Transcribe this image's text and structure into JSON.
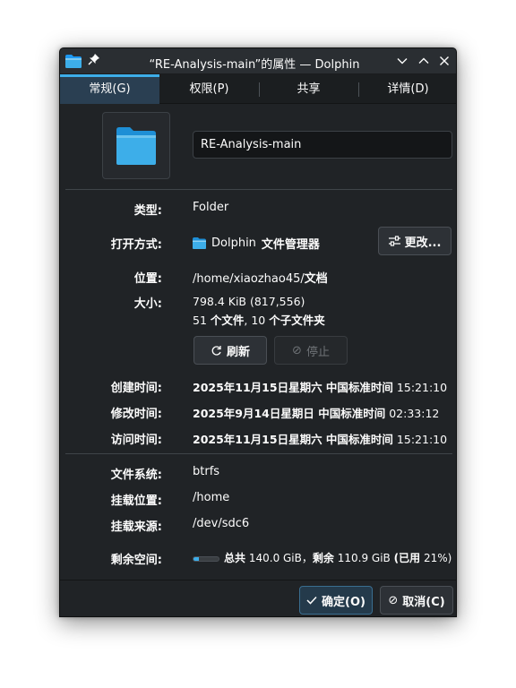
{
  "window": {
    "title": "“RE-Analysis-main”的属性 — Dolphin"
  },
  "tabs": [
    {
      "label": "常规(G)",
      "active": true
    },
    {
      "label": "权限(P)"
    },
    {
      "label": "共享"
    },
    {
      "label": "详情(D)"
    }
  ],
  "name_field": {
    "value": "RE-Analysis-main"
  },
  "rows": {
    "type": {
      "label": "类型:",
      "value": "Folder"
    },
    "open_with": {
      "label": "打开方式:",
      "app": "Dolphin",
      "app_desc": "文件管理器",
      "change_button": "更改..."
    },
    "location": {
      "label": "位置:",
      "value": "/home/xiaozhao45/",
      "value_bold": "文档"
    },
    "size": {
      "label": "大小:",
      "line1": "798.4 KiB (817,556)",
      "files_count": "51",
      "files_label": "个文件",
      "sep": ", ",
      "dirs_count": "10",
      "dirs_label": "个子文件夹"
    },
    "refresh_button": "刷新",
    "stop_button": "停止",
    "created": {
      "label": "创建时间:",
      "date_bold": "2025年11月15日星期六 中国标准时间",
      "time": "15:21:10"
    },
    "modified": {
      "label": "修改时间:",
      "date_bold": "2025年9月14日星期日 中国标准时间",
      "time": "02:33:12"
    },
    "accessed": {
      "label": "访问时间:",
      "date_bold": "2025年11月15日星期六 中国标准时间",
      "time": "15:21:10"
    },
    "filesystem": {
      "label": "文件系统:",
      "value": "btrfs"
    },
    "mount_point": {
      "label": "挂载位置:",
      "value": "/home"
    },
    "mount_source": {
      "label": "挂载来源:",
      "value": "/dev/sdc6"
    },
    "free_space": {
      "label": "剩余空间:",
      "total_label": "总共",
      "total": "140.0 GiB，",
      "free_label": "剩余",
      "free": "110.9 GiB",
      "used_label": "(已用",
      "used_pct": "21%)",
      "used_fraction": 0.21
    }
  },
  "footer": {
    "ok_button": "确定(O)",
    "cancel_button": "取消(C)"
  },
  "colors": {
    "accent": "#3daee9",
    "folder": "#3daee9",
    "background": "#202326"
  }
}
